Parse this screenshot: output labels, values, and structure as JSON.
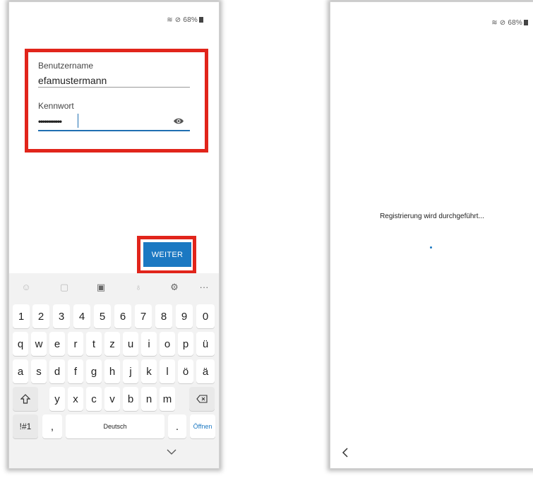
{
  "status_bar": {
    "battery": "68%"
  },
  "login": {
    "username_label": "Benutzername",
    "username_value": "efamustermann",
    "password_label": "Kennwort",
    "password_value": "••••••••••••",
    "continue_label": "WEITER"
  },
  "keyboard": {
    "toolbar_more": "···",
    "row_numbers": [
      "1",
      "2",
      "3",
      "4",
      "5",
      "6",
      "7",
      "8",
      "9",
      "0"
    ],
    "row1": [
      "q",
      "w",
      "e",
      "r",
      "t",
      "z",
      "u",
      "i",
      "o",
      "p",
      "ü"
    ],
    "row2": [
      "a",
      "s",
      "d",
      "f",
      "g",
      "h",
      "j",
      "k",
      "l",
      "ö",
      "ä"
    ],
    "row3": [
      "y",
      "x",
      "c",
      "v",
      "b",
      "n",
      "m"
    ],
    "symbols_label": "!#1",
    "comma_label": ",",
    "space_label": "Deutsch",
    "period_label": ".",
    "enter_label": "Öffnen"
  },
  "progress": {
    "text": "Registrierung wird durchgeführt..."
  },
  "colors": {
    "accent": "#1b78c2",
    "highlight": "#e1251b"
  }
}
